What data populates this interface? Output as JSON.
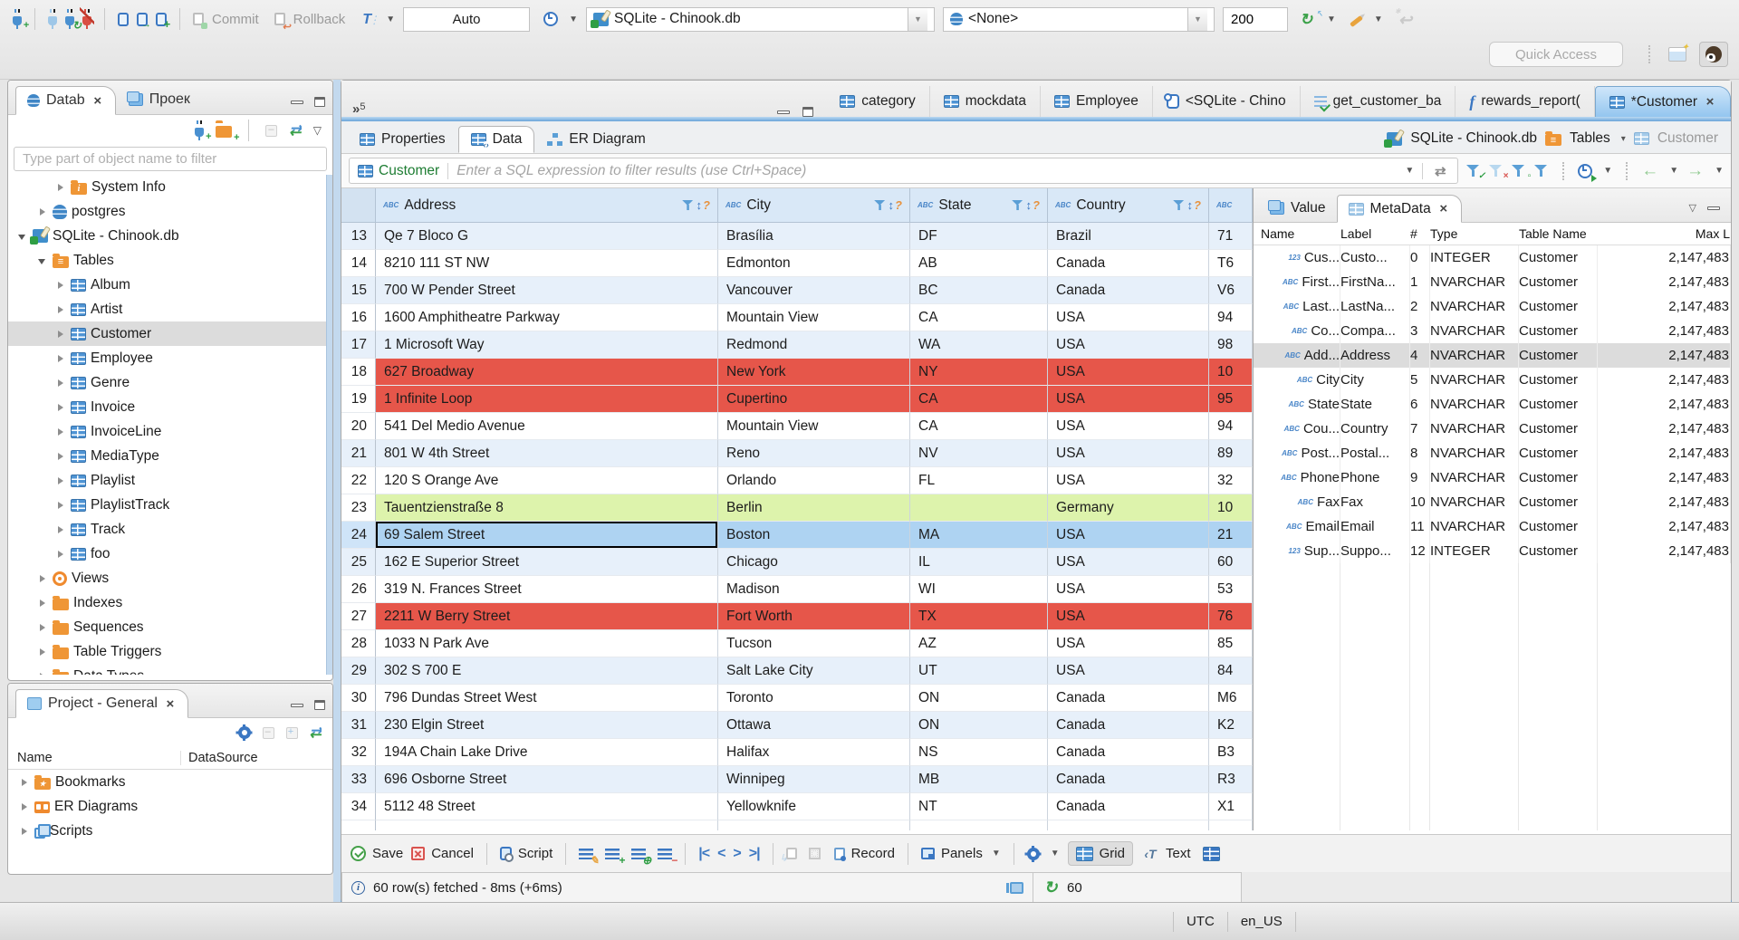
{
  "chrome": {
    "commit": "Commit",
    "rollback": "Rollback",
    "tx_mode": "Auto",
    "db_combo": "SQLite - Chinook.db",
    "schema_combo": "<None>",
    "fetch_size": "200",
    "quick_access": "Quick Access"
  },
  "navigator": {
    "tab_db": "Datab",
    "tab_project": "Проек",
    "filter_placeholder": "Type part of object name to filter",
    "tree": [
      {
        "label": "System Info",
        "icon": "folder-info",
        "arrow": "arr-r",
        "indent": 52
      },
      {
        "label": "postgres",
        "icon": "db",
        "arrow": "arr-r",
        "indent": 32
      },
      {
        "label": "SQLite - Chinook.db",
        "icon": "sqlite",
        "arrow": "arr-d",
        "indent": 10
      },
      {
        "label": "Tables",
        "icon": "folder-table",
        "arrow": "arr-d",
        "indent": 32
      },
      {
        "label": "Album",
        "icon": "table",
        "arrow": "arr-r",
        "indent": 52
      },
      {
        "label": "Artist",
        "icon": "table",
        "arrow": "arr-r",
        "indent": 52
      },
      {
        "label": "Customer",
        "icon": "table",
        "arrow": "arr-r",
        "indent": 52,
        "state": "selected"
      },
      {
        "label": "Employee",
        "icon": "table",
        "arrow": "arr-r",
        "indent": 52
      },
      {
        "label": "Genre",
        "icon": "table",
        "arrow": "arr-r",
        "indent": 52
      },
      {
        "label": "Invoice",
        "icon": "table",
        "arrow": "arr-r",
        "indent": 52
      },
      {
        "label": "InvoiceLine",
        "icon": "table",
        "arrow": "arr-r",
        "indent": 52
      },
      {
        "label": "MediaType",
        "icon": "table",
        "arrow": "arr-r",
        "indent": 52
      },
      {
        "label": "Playlist",
        "icon": "table",
        "arrow": "arr-r",
        "indent": 52
      },
      {
        "label": "PlaylistTrack",
        "icon": "table",
        "arrow": "arr-r",
        "indent": 52
      },
      {
        "label": "Track",
        "icon": "table",
        "arrow": "arr-r",
        "indent": 52
      },
      {
        "label": "foo",
        "icon": "table",
        "arrow": "arr-r",
        "indent": 52
      },
      {
        "label": "Views",
        "icon": "eye",
        "arrow": "arr-r",
        "indent": 32
      },
      {
        "label": "Indexes",
        "icon": "folder-plain",
        "arrow": "arr-r",
        "indent": 32
      },
      {
        "label": "Sequences",
        "icon": "folder-plain",
        "arrow": "arr-r",
        "indent": 32
      },
      {
        "label": "Table Triggers",
        "icon": "folder-plain",
        "arrow": "arr-r",
        "indent": 32
      },
      {
        "label": "Data Types",
        "icon": "folder-plain",
        "arrow": "arr-r",
        "indent": 32
      }
    ]
  },
  "project": {
    "title": "Project - General",
    "columns": {
      "name": "Name",
      "datasource": "DataSource"
    },
    "items": [
      {
        "label": "Bookmarks",
        "icon": "folder-star"
      },
      {
        "label": "ER Diagrams",
        "icon": "er"
      },
      {
        "label": "Scripts",
        "icon": "scripts"
      }
    ]
  },
  "editor": {
    "tabs": [
      {
        "label": "category",
        "icon": "table"
      },
      {
        "label": "mockdata",
        "icon": "table"
      },
      {
        "label": "Employee",
        "icon": "table"
      },
      {
        "label": "<SQLite - Chino",
        "icon": "sql"
      },
      {
        "label": "get_customer_ba",
        "icon": "script-check"
      },
      {
        "label": "rewards_report(",
        "icon": "func"
      },
      {
        "label": "*Customer",
        "icon": "table",
        "state": "active",
        "close": "1"
      }
    ],
    "overflow_glyph": "»",
    "overflow_count": "5",
    "subtabs": [
      {
        "label": "Properties",
        "icon": "table"
      },
      {
        "label": "Data",
        "icon": "data",
        "state": "active"
      },
      {
        "label": "ER Diagram",
        "icon": "erd"
      }
    ],
    "breadcrumb": {
      "db": "SQLite - Chinook.db",
      "tables": "Tables",
      "entity": "Customer"
    },
    "filter": {
      "entity": "Customer",
      "placeholder": "Enter a SQL expression to filter results (use Ctrl+Space)"
    }
  },
  "grid": {
    "columns": [
      {
        "label": "Address",
        "cls": "c0"
      },
      {
        "label": "City",
        "cls": "c1"
      },
      {
        "label": "State",
        "cls": "c2"
      },
      {
        "label": "Country",
        "cls": "c3"
      },
      {
        "label": "",
        "cls": "c4 last"
      }
    ],
    "rows": [
      {
        "num": "13",
        "cells": [
          "Qe 7 Bloco G",
          "Brasília",
          "DF",
          "Brazil",
          "71"
        ],
        "state": "alt"
      },
      {
        "num": "14",
        "cells": [
          "8210 111 ST NW",
          "Edmonton",
          "AB",
          "Canada",
          "T6"
        ],
        "state": ""
      },
      {
        "num": "15",
        "cells": [
          "700 W Pender Street",
          "Vancouver",
          "BC",
          "Canada",
          "V6"
        ],
        "state": "alt"
      },
      {
        "num": "16",
        "cells": [
          "1600 Amphitheatre Parkway",
          "Mountain View",
          "CA",
          "USA",
          "94"
        ],
        "state": ""
      },
      {
        "num": "17",
        "cells": [
          "1 Microsoft Way",
          "Redmond",
          "WA",
          "USA",
          "98"
        ],
        "state": "alt"
      },
      {
        "num": "18",
        "cells": [
          "627 Broadway",
          "New York",
          "NY",
          "USA",
          "10"
        ],
        "state": "red"
      },
      {
        "num": "19",
        "cells": [
          "1 Infinite Loop",
          "Cupertino",
          "CA",
          "USA",
          "95"
        ],
        "state": "red"
      },
      {
        "num": "20",
        "cells": [
          "541 Del Medio Avenue",
          "Mountain View",
          "CA",
          "USA",
          "94"
        ],
        "state": ""
      },
      {
        "num": "21",
        "cells": [
          "801 W 4th Street",
          "Reno",
          "NV",
          "USA",
          "89"
        ],
        "state": "alt"
      },
      {
        "num": "22",
        "cells": [
          "120 S Orange Ave",
          "Orlando",
          "FL",
          "USA",
          "32"
        ],
        "state": ""
      },
      {
        "num": "23",
        "cells": [
          "Tauentzienstraße 8",
          "Berlin",
          "",
          "Germany",
          "10"
        ],
        "state": "green"
      },
      {
        "num": "24",
        "cells": [
          "69 Salem Street",
          "Boston",
          "MA",
          "USA",
          "21"
        ],
        "state": "sel"
      },
      {
        "num": "25",
        "cells": [
          "162 E Superior Street",
          "Chicago",
          "IL",
          "USA",
          "60"
        ],
        "state": "alt"
      },
      {
        "num": "26",
        "cells": [
          "319 N. Frances Street",
          "Madison",
          "WI",
          "USA",
          "53"
        ],
        "state": ""
      },
      {
        "num": "27",
        "cells": [
          "2211 W Berry Street",
          "Fort Worth",
          "TX",
          "USA",
          "76"
        ],
        "state": "red"
      },
      {
        "num": "28",
        "cells": [
          "1033 N Park Ave",
          "Tucson",
          "AZ",
          "USA",
          "85"
        ],
        "state": ""
      },
      {
        "num": "29",
        "cells": [
          "302 S 700 E",
          "Salt Lake City",
          "UT",
          "USA",
          "84"
        ],
        "state": "alt"
      },
      {
        "num": "30",
        "cells": [
          "796 Dundas Street West",
          "Toronto",
          "ON",
          "Canada",
          "M6"
        ],
        "state": ""
      },
      {
        "num": "31",
        "cells": [
          "230 Elgin Street",
          "Ottawa",
          "ON",
          "Canada",
          "K2"
        ],
        "state": "alt"
      },
      {
        "num": "32",
        "cells": [
          "194A Chain Lake Drive",
          "Halifax",
          "NS",
          "Canada",
          "B3"
        ],
        "state": ""
      },
      {
        "num": "33",
        "cells": [
          "696 Osborne Street",
          "Winnipeg",
          "MB",
          "Canada",
          "R3"
        ],
        "state": "alt"
      },
      {
        "num": "34",
        "cells": [
          "5112 48 Street",
          "Yellowknife",
          "NT",
          "Canada",
          "X1"
        ],
        "state": ""
      }
    ]
  },
  "panel": {
    "tab_value": "Value",
    "tab_metadata": "MetaData",
    "columns": [
      "Name",
      "Label",
      "#",
      "Type",
      "Table Name",
      "Max L"
    ],
    "rows": [
      {
        "icon": "123",
        "name": "Cus...",
        "label": "Custo...",
        "num": "0",
        "type": "INTEGER",
        "table": "Customer",
        "max": "2,147,483"
      },
      {
        "icon": "abc",
        "name": "First...",
        "label": "FirstNa...",
        "num": "1",
        "type": "NVARCHAR",
        "table": "Customer",
        "max": "2,147,483"
      },
      {
        "icon": "abc",
        "name": "Last...",
        "label": "LastNa...",
        "num": "2",
        "type": "NVARCHAR",
        "table": "Customer",
        "max": "2,147,483"
      },
      {
        "icon": "abc",
        "name": "Co...",
        "label": "Compa...",
        "num": "3",
        "type": "NVARCHAR",
        "table": "Customer",
        "max": "2,147,483"
      },
      {
        "icon": "abc",
        "name": "Add...",
        "label": "Address",
        "num": "4",
        "type": "NVARCHAR",
        "table": "Customer",
        "max": "2,147,483",
        "state": "selected"
      },
      {
        "icon": "abc",
        "name": "City",
        "label": "City",
        "num": "5",
        "type": "NVARCHAR",
        "table": "Customer",
        "max": "2,147,483"
      },
      {
        "icon": "abc",
        "name": "State",
        "label": "State",
        "num": "6",
        "type": "NVARCHAR",
        "table": "Customer",
        "max": "2,147,483"
      },
      {
        "icon": "abc",
        "name": "Cou...",
        "label": "Country",
        "num": "7",
        "type": "NVARCHAR",
        "table": "Customer",
        "max": "2,147,483"
      },
      {
        "icon": "abc",
        "name": "Post...",
        "label": "Postal...",
        "num": "8",
        "type": "NVARCHAR",
        "table": "Customer",
        "max": "2,147,483"
      },
      {
        "icon": "abc",
        "name": "Phone",
        "label": "Phone",
        "num": "9",
        "type": "NVARCHAR",
        "table": "Customer",
        "max": "2,147,483"
      },
      {
        "icon": "abc",
        "name": "Fax",
        "label": "Fax",
        "num": "10",
        "type": "NVARCHAR",
        "table": "Customer",
        "max": "2,147,483"
      },
      {
        "icon": "abc",
        "name": "Email",
        "label": "Email",
        "num": "11",
        "type": "NVARCHAR",
        "table": "Customer",
        "max": "2,147,483"
      },
      {
        "icon": "123",
        "name": "Sup...",
        "label": "Suppo...",
        "num": "12",
        "type": "INTEGER",
        "table": "Customer",
        "max": "2,147,483"
      }
    ]
  },
  "result_toolbar": {
    "save": "Save",
    "cancel": "Cancel",
    "script": "Script",
    "record": "Record",
    "panels": "Panels",
    "grid": "Grid",
    "text": "Text"
  },
  "status": {
    "message": "60 row(s) fetched - 8ms (+6ms)",
    "fetch_count": "60"
  },
  "statusbar": {
    "timezone": "UTC",
    "locale": "en_US"
  }
}
